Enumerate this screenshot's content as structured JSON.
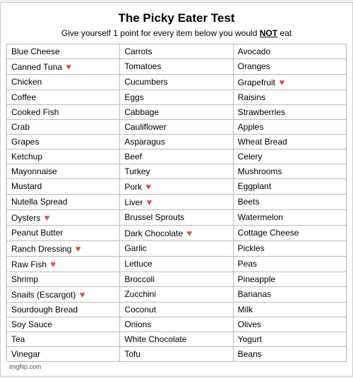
{
  "title": "The Picky Eater Test",
  "subtitle_plain": "Give yourself 1 point for every item below you would ",
  "subtitle_underline": "NOT",
  "subtitle_end": " eat",
  "rows": [
    [
      "Blue Cheese",
      "Carrots",
      "Avocado"
    ],
    [
      "Canned Tuna ❤",
      "Tomatoes",
      "Oranges"
    ],
    [
      "Chicken",
      "Cucumbers",
      "Grapefruit ❤"
    ],
    [
      "Coffee",
      "Eggs",
      "Raisins"
    ],
    [
      "Cooked Fish",
      "Cabbage",
      "Strawberries"
    ],
    [
      "Crab",
      "Cauliflower",
      "Apples"
    ],
    [
      "Grapes",
      "Asparagus",
      "Wheat Bread"
    ],
    [
      "Ketchup",
      "Beef",
      "Celery"
    ],
    [
      "Mayonnaise",
      "Turkey",
      "Mushrooms"
    ],
    [
      "Mustard",
      "Pork ❤",
      "Eggplant"
    ],
    [
      "Nutella Spread",
      "Liver ❤",
      "Beets"
    ],
    [
      "Oysters ❤",
      "Brussel Sprouts",
      "Watermelon"
    ],
    [
      "Peanut Butter",
      "Dark Chocolate ❤",
      "Cottage Cheese"
    ],
    [
      "Ranch Dressing ❤",
      "Garlic",
      "Pickles"
    ],
    [
      "Raw Fish ❤",
      "Lettuce",
      "Peas"
    ],
    [
      "Shrimp",
      "Broccoli",
      "Pineapple"
    ],
    [
      "Snails (Escargot) ❤",
      "Zucchini",
      "Bananas"
    ],
    [
      "Sourdough Bread",
      "Coconut",
      "Milk"
    ],
    [
      "Soy Sauce",
      "Onions",
      "Olives"
    ],
    [
      "Tea",
      "White Chocolate",
      "Yogurt"
    ],
    [
      "Vinegar",
      "Tofu",
      "Beans"
    ]
  ],
  "watermark": "imgflip.com"
}
